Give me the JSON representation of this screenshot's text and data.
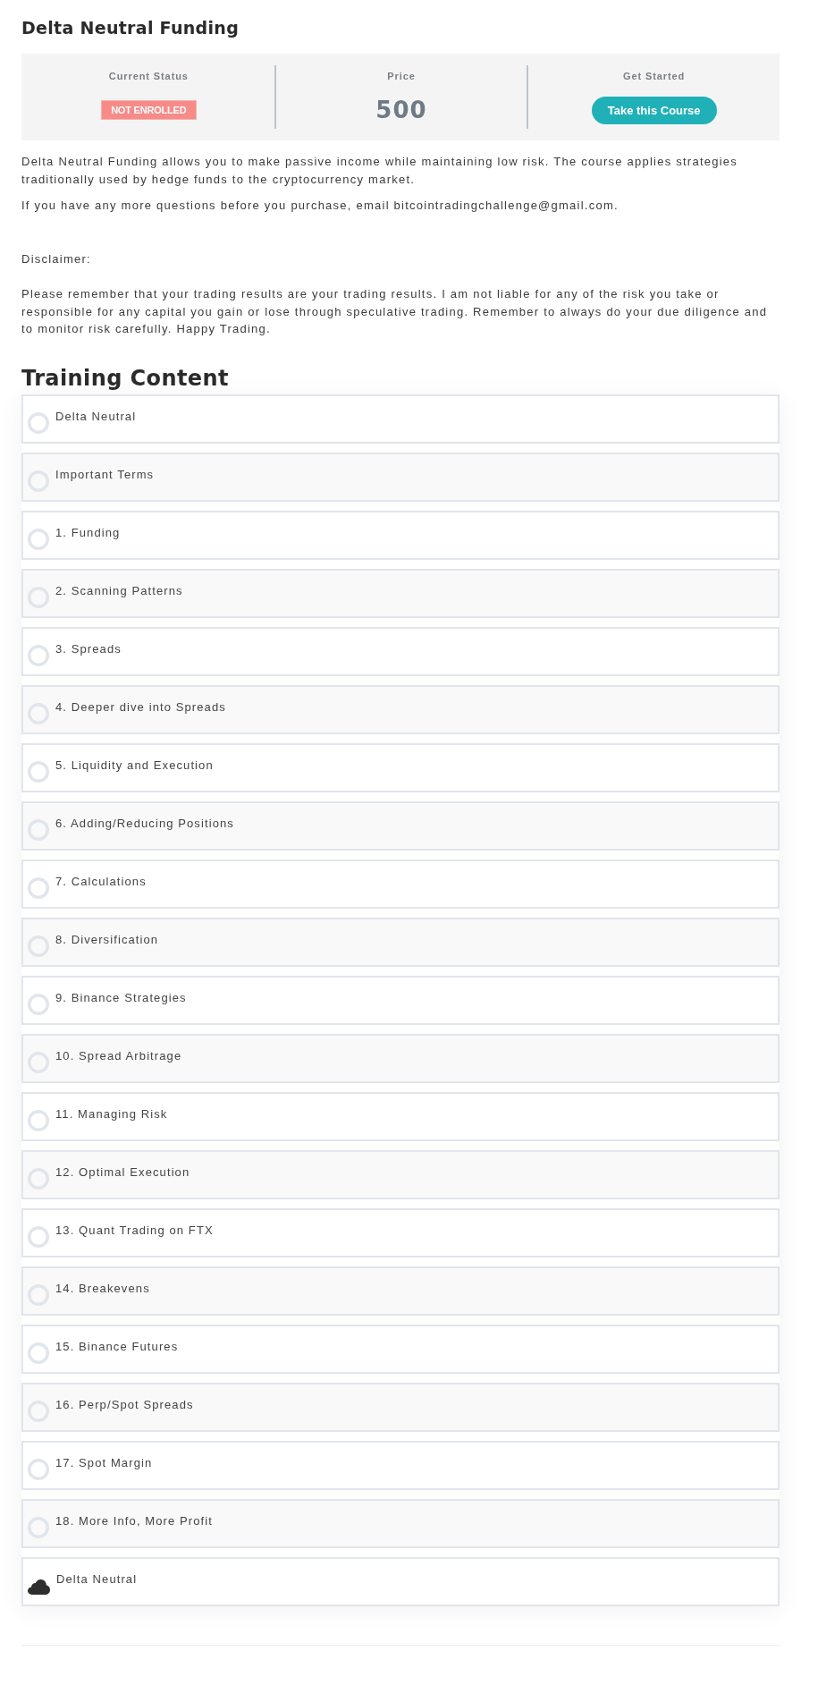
{
  "course": {
    "title": "Delta Neutral Funding"
  },
  "status_panel": {
    "columns": [
      {
        "kind": "badge",
        "label": "Current Status",
        "value": "NOT ENROLLED"
      },
      {
        "kind": "price",
        "label": "Price",
        "value": "500"
      },
      {
        "kind": "button",
        "label": "Get Started",
        "value": "Take this Course"
      }
    ]
  },
  "description": [
    "Delta Neutral Funding allows you to make passive income while maintaining low risk. The course applies strategies traditionally used by hedge funds to the cryptocurrency market.",
    "If you have any more questions before you purchase, email bitcointradingchallenge@gmail.com."
  ],
  "disclaimer": {
    "heading": "Disclaimer:",
    "text": "Please remember that your trading results are your trading results. I am not liable for any of the risk you take or responsible for any capital you gain or lose through speculative trading. Remember to always do your due diligence and to monitor risk carefully. Happy Trading."
  },
  "training_content": {
    "title": "Training Content",
    "items": [
      {
        "kind": "lesson",
        "title": "Delta Neutral"
      },
      {
        "kind": "lesson",
        "title": "Important Terms"
      },
      {
        "kind": "lesson",
        "title": "1. Funding"
      },
      {
        "kind": "lesson",
        "title": "2. Scanning Patterns"
      },
      {
        "kind": "lesson",
        "title": "3. Spreads"
      },
      {
        "kind": "lesson",
        "title": "4. Deeper dive into Spreads"
      },
      {
        "kind": "lesson",
        "title": "5. Liquidity and Execution"
      },
      {
        "kind": "lesson",
        "title": "6. Adding/Reducing Positions"
      },
      {
        "kind": "lesson",
        "title": "7. Calculations"
      },
      {
        "kind": "lesson",
        "title": "8. Diversification"
      },
      {
        "kind": "lesson",
        "title": "9. Binance Strategies"
      },
      {
        "kind": "lesson",
        "title": "10. Spread Arbitrage"
      },
      {
        "kind": "lesson",
        "title": "11. Managing Risk"
      },
      {
        "kind": "lesson",
        "title": "12. Optimal Execution"
      },
      {
        "kind": "lesson",
        "title": "13. Quant Trading on FTX"
      },
      {
        "kind": "lesson",
        "title": "14. Breakevens"
      },
      {
        "kind": "lesson",
        "title": "15. Binance Futures"
      },
      {
        "kind": "lesson",
        "title": "16. Perp/Spot Spreads"
      },
      {
        "kind": "lesson",
        "title": "17. Spot Margin"
      },
      {
        "kind": "lesson",
        "title": "18. More Info, More Profit"
      },
      {
        "kind": "cloud",
        "title": "Delta Neutral"
      }
    ]
  }
}
